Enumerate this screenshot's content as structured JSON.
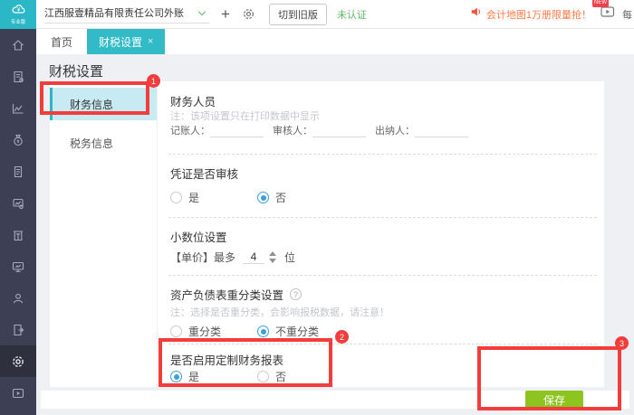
{
  "topbar": {
    "logo_text": "专业版",
    "company": "江西服壹精品有限责任公司外账",
    "plus": "+",
    "switch_old": "切到旧版",
    "unverified": "未认证",
    "promo": "会计地图1万册限量抢！",
    "new_badge": "NEW",
    "partial_text": "每"
  },
  "tabs": {
    "home": "首页",
    "active": "财税设置",
    "close": "×"
  },
  "sidebar": {
    "icons": [
      "home-icon",
      "voucher-icon",
      "report-icon",
      "money-bag-icon",
      "invoice-icon",
      "asset-icon",
      "cashier-icon",
      "statement-icon",
      "salary-icon",
      "checkout-icon",
      "settings-icon",
      "video-icon"
    ]
  },
  "page": {
    "title": "财税设置"
  },
  "submenu": {
    "items": [
      {
        "label": "财务信息",
        "active": true
      },
      {
        "label": "税务信息",
        "active": false
      }
    ]
  },
  "form": {
    "staff": {
      "title": "财务人员",
      "note": "注：该项设置只在打印数据中显示",
      "fields": [
        {
          "label": "记账人：",
          "value": ""
        },
        {
          "label": "审核人：",
          "value": ""
        },
        {
          "label": "出纳人：",
          "value": ""
        }
      ]
    },
    "voucher_audit": {
      "title": "凭证是否审核",
      "options": [
        {
          "label": "是",
          "selected": false
        },
        {
          "label": "否",
          "selected": true
        }
      ]
    },
    "decimal": {
      "title": "小数位设置",
      "prefix": "【单价】最多",
      "value": "4",
      "suffix": "位"
    },
    "reclass": {
      "title": "资产负债表重分类设置",
      "help": "?",
      "note": "注：选择是否重分类，会影响报税数据，请注意！",
      "options": [
        {
          "label": "重分类",
          "selected": false
        },
        {
          "label": "不重分类",
          "selected": true
        }
      ]
    },
    "custom_report": {
      "title": "是否启用定制财务报表",
      "options": [
        {
          "label": "是",
          "selected": true
        },
        {
          "label": "否",
          "selected": false
        }
      ]
    }
  },
  "footer": {
    "save": "保存"
  },
  "annotations": {
    "badge1": "1",
    "badge2": "2",
    "badge3": "3"
  },
  "colors": {
    "primary_teal": "#2bb7c5",
    "sidebar_dark": "#3d3f54",
    "annotation_red": "#f23d3d",
    "save_green": "#8dc41f",
    "radio_blue": "#3b9fe0",
    "promo_orange": "#ff7946",
    "verified_green": "#61b767",
    "submenu_active_bg": "#c7eaf3"
  }
}
